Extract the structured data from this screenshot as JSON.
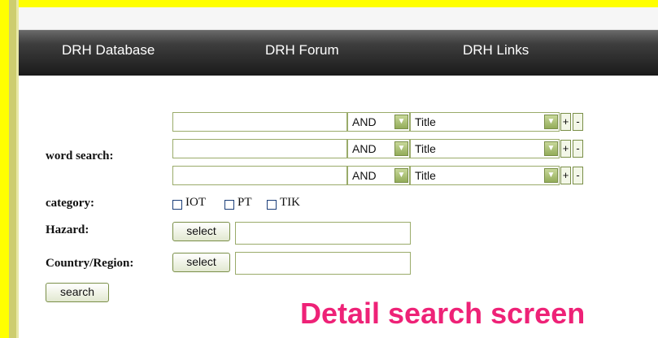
{
  "nav": {
    "items": [
      "DRH Database",
      "DRH Forum",
      "DRH Links"
    ]
  },
  "form": {
    "word_search_label": "word search:",
    "rows": [
      {
        "operator": "AND",
        "field": "Title",
        "plus": "+",
        "minus": "-"
      },
      {
        "operator": "AND",
        "field": "Title",
        "plus": "+",
        "minus": "-"
      },
      {
        "operator": "AND",
        "field": "Title",
        "plus": "+",
        "minus": "-"
      }
    ],
    "category_label": "category:",
    "categories": [
      "IOT",
      "PT",
      "TIK"
    ],
    "hazard_label": "Hazard:",
    "country_label": "Country/Region:",
    "select_label": "select",
    "search_label": "search"
  },
  "caption": "Detail search screen",
  "colors": {
    "background": "#ffff00",
    "caption": "#ee2277",
    "navbar": "#1a1a1a",
    "field_border": "#9aab6a"
  }
}
